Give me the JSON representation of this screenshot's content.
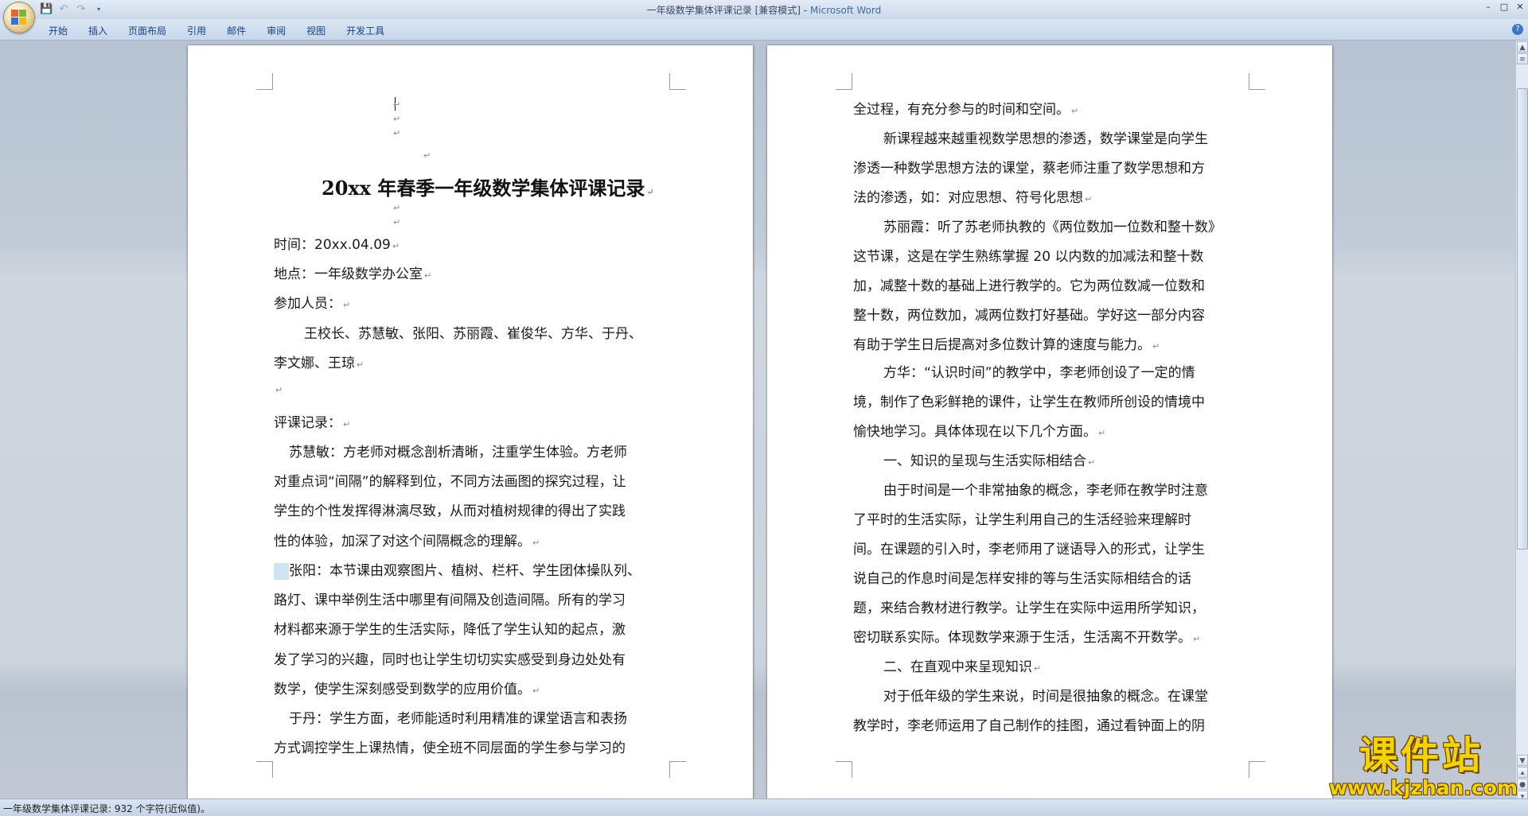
{
  "window": {
    "title_doc": "一年级数学集体评课记录 [兼容模式] - ",
    "title_app": "Microsoft Word",
    "controls": [
      "minimize-icon",
      "restore-icon",
      "close-icon"
    ]
  },
  "qat": {
    "icons": [
      "save-icon",
      "undo-icon",
      "redo-icon",
      "customize-icon"
    ]
  },
  "ribbon": {
    "tabs": [
      "开始",
      "插入",
      "页面布局",
      "引用",
      "邮件",
      "审阅",
      "视图",
      "开发工具"
    ],
    "help": "?"
  },
  "page1": {
    "title": "20xx 年春季一年级数学集体评课记录",
    "lines": [
      "时间：20xx.04.09",
      "地点：一年级数学办公室",
      "参加人员：",
      "王校长、苏慧敏、张阳、苏丽霞、崔俊华、方华、于丹、",
      "李文娜、王琼",
      "",
      "评课记录：",
      "苏慧敏：方老师对概念剖析清晰，注重学生体验。方老师",
      "对重点词“间隔”的解释到位，不同方法画图的探究过程，让",
      "学生的个性发挥得淋漓尽致，从而对植树规律的得出了实践",
      "性的体验，加深了对这个间隔概念的理解。",
      "张阳：本节课由观察图片、植树、栏杆、学生团体操队列、",
      "路灯、课中举例生活中哪里有间隔及创造间隔。所有的学习",
      "材料都来源于学生的生活实际，降低了学生认知的起点，激",
      "发了学习的兴趣，同时也让学生切切实实感受到身边处处有",
      "数学，使学生深刻感受到数学的应用价值。",
      "于丹：学生方面，老师能适时利用精准的课堂语言和表扬",
      "方式调控学生上课热情，使全班不同层面的学生参与学习的"
    ]
  },
  "page2": {
    "lines": [
      "全过程，有充分参与的时间和空间。",
      "新课程越来越重视数学思想的渗透，数学课堂是向学生",
      "渗透一种数学思想方法的课堂，蔡老师注重了数学思想和方",
      "法的渗透，如：对应思想、符号化思想",
      "苏丽霞：听了苏老师执教的《两位数加一位数和整十数》",
      "这节课，这是在学生熟练掌握 20 以内数的加减法和整十数",
      "加，减整十数的基础上进行教学的。它为两位数减一位数和",
      "整十数，两位数加，减两位数打好基础。学好这一部分内容",
      "有助于学生日后提高对多位数计算的速度与能力。",
      "方华：“认识时间”的教学中，李老师创设了一定的情",
      "境，制作了色彩鲜艳的课件，让学生在教师所创设的情境中",
      "愉快地学习。具体体现在以下几个方面。",
      "一、知识的呈现与生活实际相结合",
      "由于时间是一个非常抽象的概念，李老师在教学时注意",
      "了平时的生活实际，让学生利用自己的生活经验来理解时",
      "间。在课题的引入时，李老师用了谜语导入的形式，让学生",
      "说自己的作息时间是怎样安排的等与生活实际相结合的话",
      "题，来结合教材进行教学。让学生在实际中运用所学知识，",
      "密切联系实际。体现数学来源于生活，生活离不开数学。",
      "二、在直观中来呈现知识",
      "对于低年级的学生来说，时间是很抽象的概念。在课堂",
      "教学时，李老师运用了自己制作的挂图，通过看钟面上的阴"
    ]
  },
  "paragraph_mark": "↵",
  "status": {
    "text": "一年级数学集体评课记录: 932 个字符(近似值)。"
  },
  "watermark": {
    "title": "课件站",
    "url": "www.kjzhan.com"
  }
}
